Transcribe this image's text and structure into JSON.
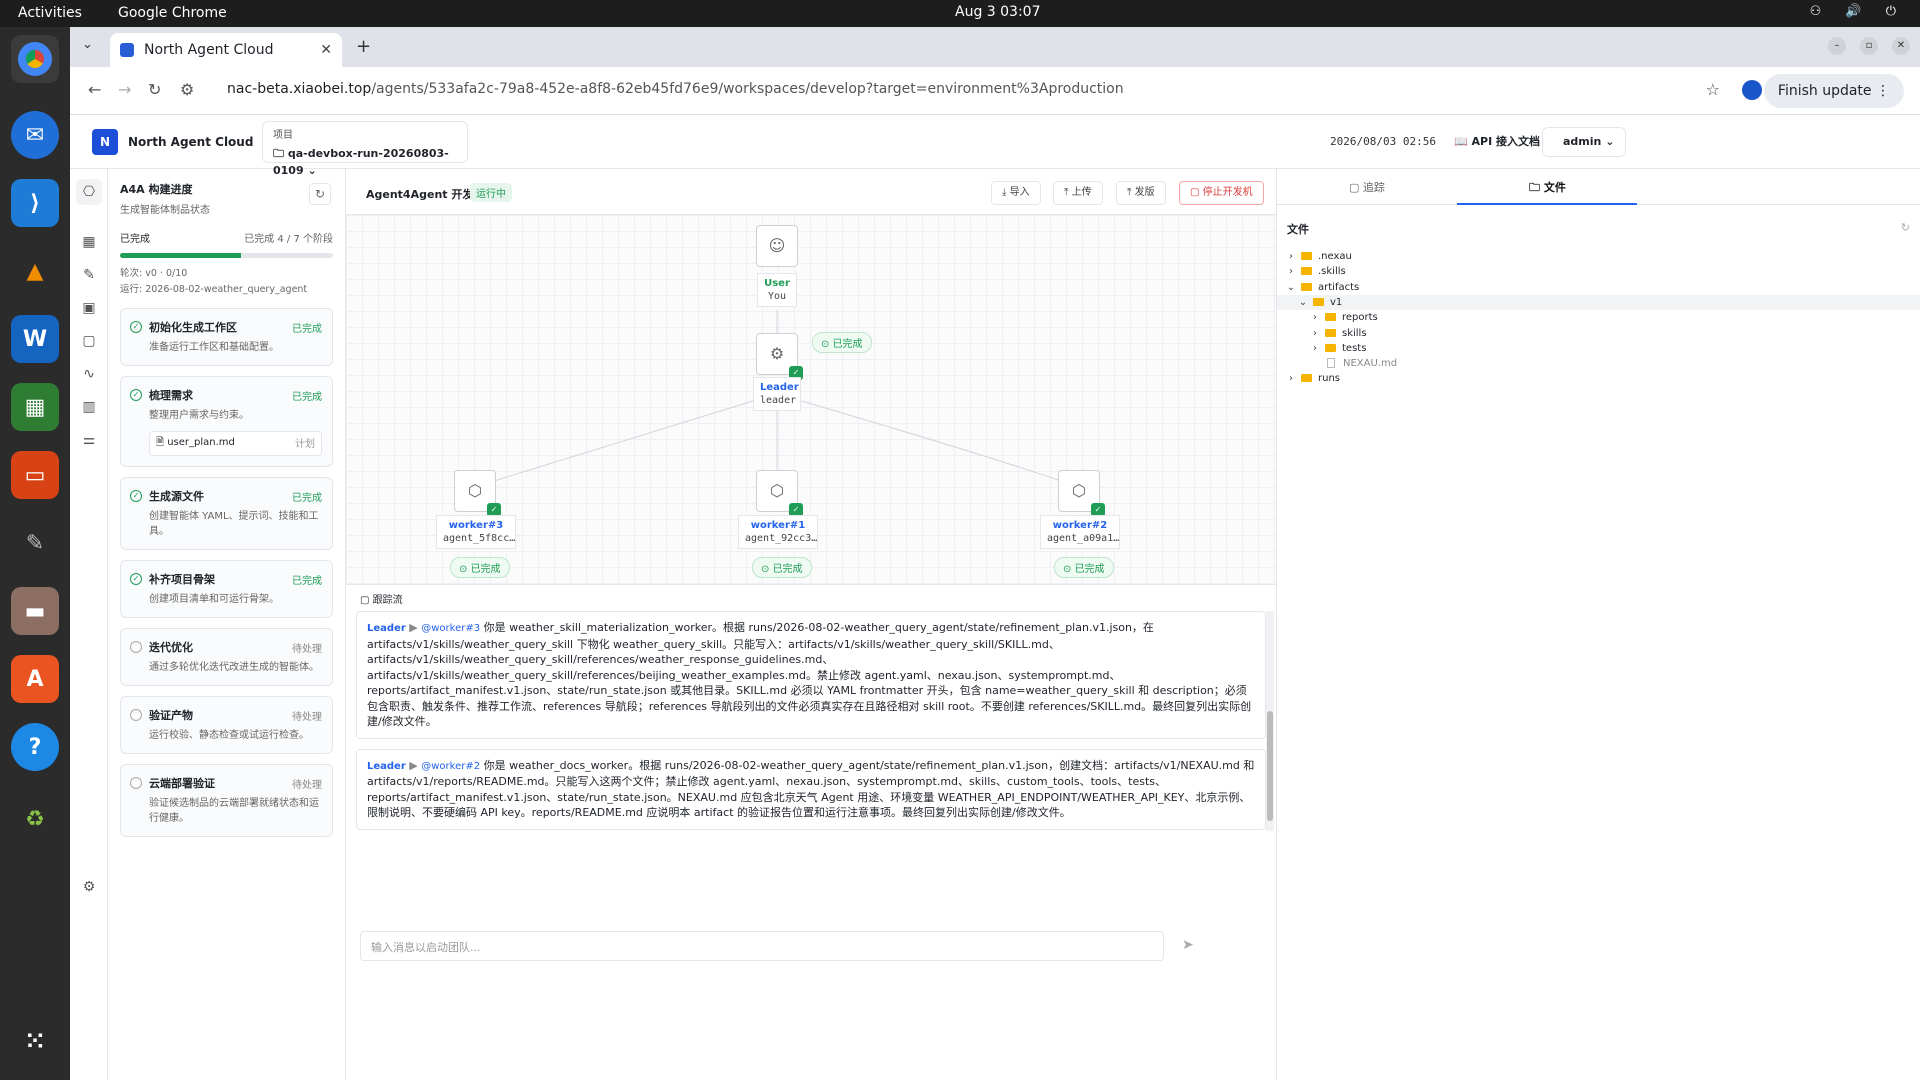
{
  "desktop": {
    "activities": "Activities",
    "app_name": "Google Chrome",
    "clock": "Aug 3  03:07"
  },
  "browser": {
    "tab_title": "North Agent Cloud",
    "url_host": "nac-beta.xiaobei.top",
    "url_path": "/agents/533afa2c-79a8-452e-a8f8-62eb45fd76e9/workspaces/develop?target=environment%3Aproduction",
    "finish_update": "Finish update"
  },
  "app": {
    "brand": "North Agent Cloud",
    "project_label": "项目",
    "project_value": "qa-devbox-run-20260803-0109",
    "datetime": "2026/08/03 02:56",
    "api_doc": "API 接入文档",
    "user": "admin"
  },
  "progress": {
    "title": "A4A 构建进度",
    "subtitle": "生成智能体制品状态",
    "done_label": "已完成",
    "stage_count": "已完成 4 / 7 个阶段",
    "fraction": 0.57,
    "round": "轮次: v0 · 0/10",
    "run": "运行: 2026-08-02-weather_query_agent",
    "stages": [
      {
        "title": "初始化生成工作区",
        "status": "已完成",
        "desc": "准备运行工作区和基础配置。"
      },
      {
        "title": "梳理需求",
        "status": "已完成",
        "desc": "整理用户需求与约束。",
        "file": "user_plan.md",
        "file_tag": "计划"
      },
      {
        "title": "生成源文件",
        "status": "已完成",
        "desc": "创建智能体 YAML、提示词、技能和工具。"
      },
      {
        "title": "补齐项目骨架",
        "status": "已完成",
        "desc": "创建项目清单和可运行骨架。"
      },
      {
        "title": "迭代优化",
        "status": "待处理",
        "desc": "通过多轮优化迭代改进生成的智能体。"
      },
      {
        "title": "验证产物",
        "status": "待处理",
        "desc": "运行校验、静态检查或试运行检查。"
      },
      {
        "title": "云端部署验证",
        "status": "待处理",
        "desc": "验证候选制品的云端部署就绪状态和运行健康。"
      }
    ]
  },
  "canvas": {
    "title": "Agent4Agent 开发机",
    "status": "运行中",
    "btn_import": "导入",
    "btn_upload": "上传",
    "btn_publish": "发版",
    "btn_stop": "停止开发机",
    "user_node": {
      "name": "User",
      "sub": "You"
    },
    "leader_node": {
      "name": "Leader",
      "sub": "leader",
      "badge": "已完成"
    },
    "workers": [
      {
        "name": "worker#3",
        "sub": "agent_5f8cc…",
        "badge": "已完成"
      },
      {
        "name": "worker#1",
        "sub": "agent_92cc3…",
        "badge": "已完成"
      },
      {
        "name": "worker#2",
        "sub": "agent_a09a1…",
        "badge": "已完成"
      }
    ]
  },
  "trace": {
    "title": "跟踪流",
    "messages": [
      {
        "from": "Leader",
        "to": "@worker#3",
        "text": "你是 weather_skill_materialization_worker。根据 runs/2026-08-02-weather_query_agent/state/refinement_plan.v1.json，在 artifacts/v1/skills/weather_query_skill 下物化 weather_query_skill。只能写入：artifacts/v1/skills/weather_query_skill/SKILL.md、artifacts/v1/skills/weather_query_skill/references/weather_response_guidelines.md、artifacts/v1/skills/weather_query_skill/references/beijing_weather_examples.md。禁止修改 agent.yaml、nexau.json、systemprompt.md、reports/artifact_manifest.v1.json、state/run_state.json 或其他目录。SKILL.md 必须以 YAML frontmatter 开头，包含 name=weather_query_skill 和 description；必须包含职责、触发条件、推荐工作流、references 导航段；references 导航段列出的文件必须真实存在且路径相对 skill root。不要创建 references/SKILL.md。最终回复列出实际创建/修改文件。"
      },
      {
        "from": "Leader",
        "to": "@worker#2",
        "text": "你是 weather_docs_worker。根据 runs/2026-08-02-weather_query_agent/state/refinement_plan.v1.json，创建文档：artifacts/v1/NEXAU.md 和 artifacts/v1/reports/README.md。只能写入这两个文件；禁止修改 agent.yaml、nexau.json、systemprompt.md、skills、custom_tools、tools、tests、reports/artifact_manifest.v1.json、state/run_state.json。NEXAU.md 应包含北京天气 Agent 用途、环境变量 WEATHER_API_ENDPOINT/WEATHER_API_KEY、北京示例、限制说明、不要硬编码 API key。reports/README.md 应说明本 artifact 的验证报告位置和运行注意事项。最终回复列出实际创建/修改文件。"
      }
    ],
    "composer_placeholder": "输入消息以启动团队..."
  },
  "files": {
    "tab_trace": "追踪",
    "tab_files": "文件",
    "header": "文件",
    "tree": [
      {
        "name": ".nexau",
        "type": "folder",
        "depth": 0,
        "open": false
      },
      {
        "name": ".skills",
        "type": "folder",
        "depth": 0,
        "open": false
      },
      {
        "name": "artifacts",
        "type": "folder",
        "depth": 0,
        "open": true
      },
      {
        "name": "v1",
        "type": "folder",
        "depth": 1,
        "open": true
      },
      {
        "name": "reports",
        "type": "folder",
        "depth": 2,
        "open": false
      },
      {
        "name": "skills",
        "type": "folder",
        "depth": 2,
        "open": false
      },
      {
        "name": "tests",
        "type": "folder",
        "depth": 2,
        "open": false
      },
      {
        "name": "NEXAU.md",
        "type": "file",
        "depth": 2
      },
      {
        "name": "runs",
        "type": "folder",
        "depth": 0,
        "open": false
      }
    ]
  }
}
